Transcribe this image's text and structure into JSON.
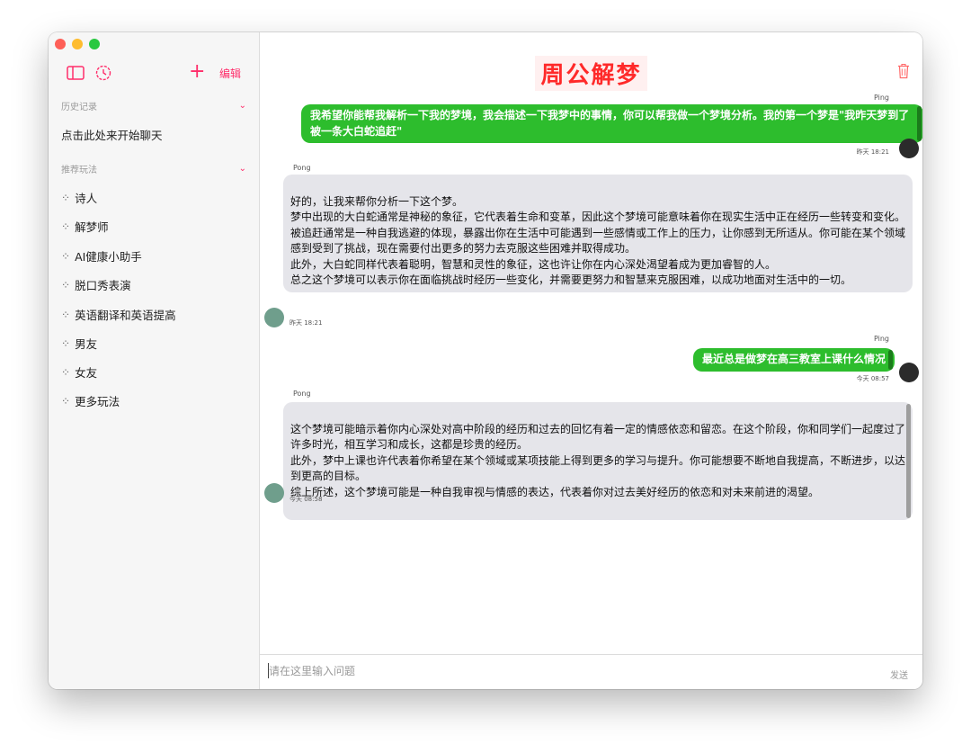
{
  "app": {
    "title": "周公解梦"
  },
  "sidebar": {
    "add_label": "+",
    "edit_label": "编辑",
    "history": {
      "title": "历史记录",
      "items": [
        "点击此处来开始聊天"
      ]
    },
    "recommended": {
      "title": "推荐玩法",
      "items": [
        "诗人",
        "解梦师",
        "AI健康小助手",
        "脱口秀表演",
        "英语翻译和英语提高",
        "男友",
        "女友",
        "更多玩法"
      ]
    }
  },
  "messages": [
    {
      "sender": "Ping",
      "role": "user",
      "text": "我希望你能帮我解析一下我的梦境，我会描述一下我梦中的事情，你可以帮我做一个梦境分析。我的第一个梦是\"我昨天梦到了被一条大白蛇追赶\"",
      "time": "昨天 18:21"
    },
    {
      "sender": "Pong",
      "role": "bot",
      "text": "好的，让我来帮你分析一下这个梦。\n梦中出现的大白蛇通常是神秘的象征，它代表着生命和变革，因此这个梦境可能意味着你在现实生活中正在经历一些转变和变化。\n被追赶通常是一种自我逃避的体现，暴露出你在生活中可能遇到一些感情或工作上的压力，让你感到无所适从。你可能在某个领域感到受到了挑战，现在需要付出更多的努力去克服这些困难并取得成功。\n此外，大白蛇同样代表着聪明，智慧和灵性的象征，这也许让你在内心深处渴望着成为更加睿智的人。\n总之这个梦境可以表示你在面临挑战时经历一些变化，并需要更努力和智慧来克服困难，以成功地面对生活中的一切。",
      "time": "昨天 18:21"
    },
    {
      "sender": "Ping",
      "role": "user",
      "text": "最近总是做梦在高三教室上课什么情况",
      "time": "今天 08:57"
    },
    {
      "sender": "Pong",
      "role": "bot",
      "text": "这个梦境可能暗示着你内心深处对高中阶段的经历和过去的回忆有着一定的情感依恋和留恋。在这个阶段，你和同学们一起度过了许多时光，相互学习和成长，这都是珍贵的经历。\n此外，梦中上课也许代表着你希望在某个领域或某项技能上得到更多的学习与提升。你可能想要不断地自我提高，不断进步，以达到更高的目标。\n综上所述，这个梦境可能是一种自我审视与情感的表达，代表着你对过去美好经历的依恋和对未来前进的渴望。",
      "time": "今天 08:58"
    }
  ],
  "input": {
    "placeholder": "请在这里输入问题",
    "value": "",
    "send_label": "发送"
  },
  "colors": {
    "accent": "#ff2d6a",
    "user_bubble": "#2dbd2d",
    "bot_bubble": "#e5e5ea",
    "title": "#ff2a2a"
  },
  "icons": [
    "sidebar-toggle-icon",
    "clock-icon",
    "trash-icon",
    "chevron-down-icon",
    "sparkle-icon"
  ]
}
